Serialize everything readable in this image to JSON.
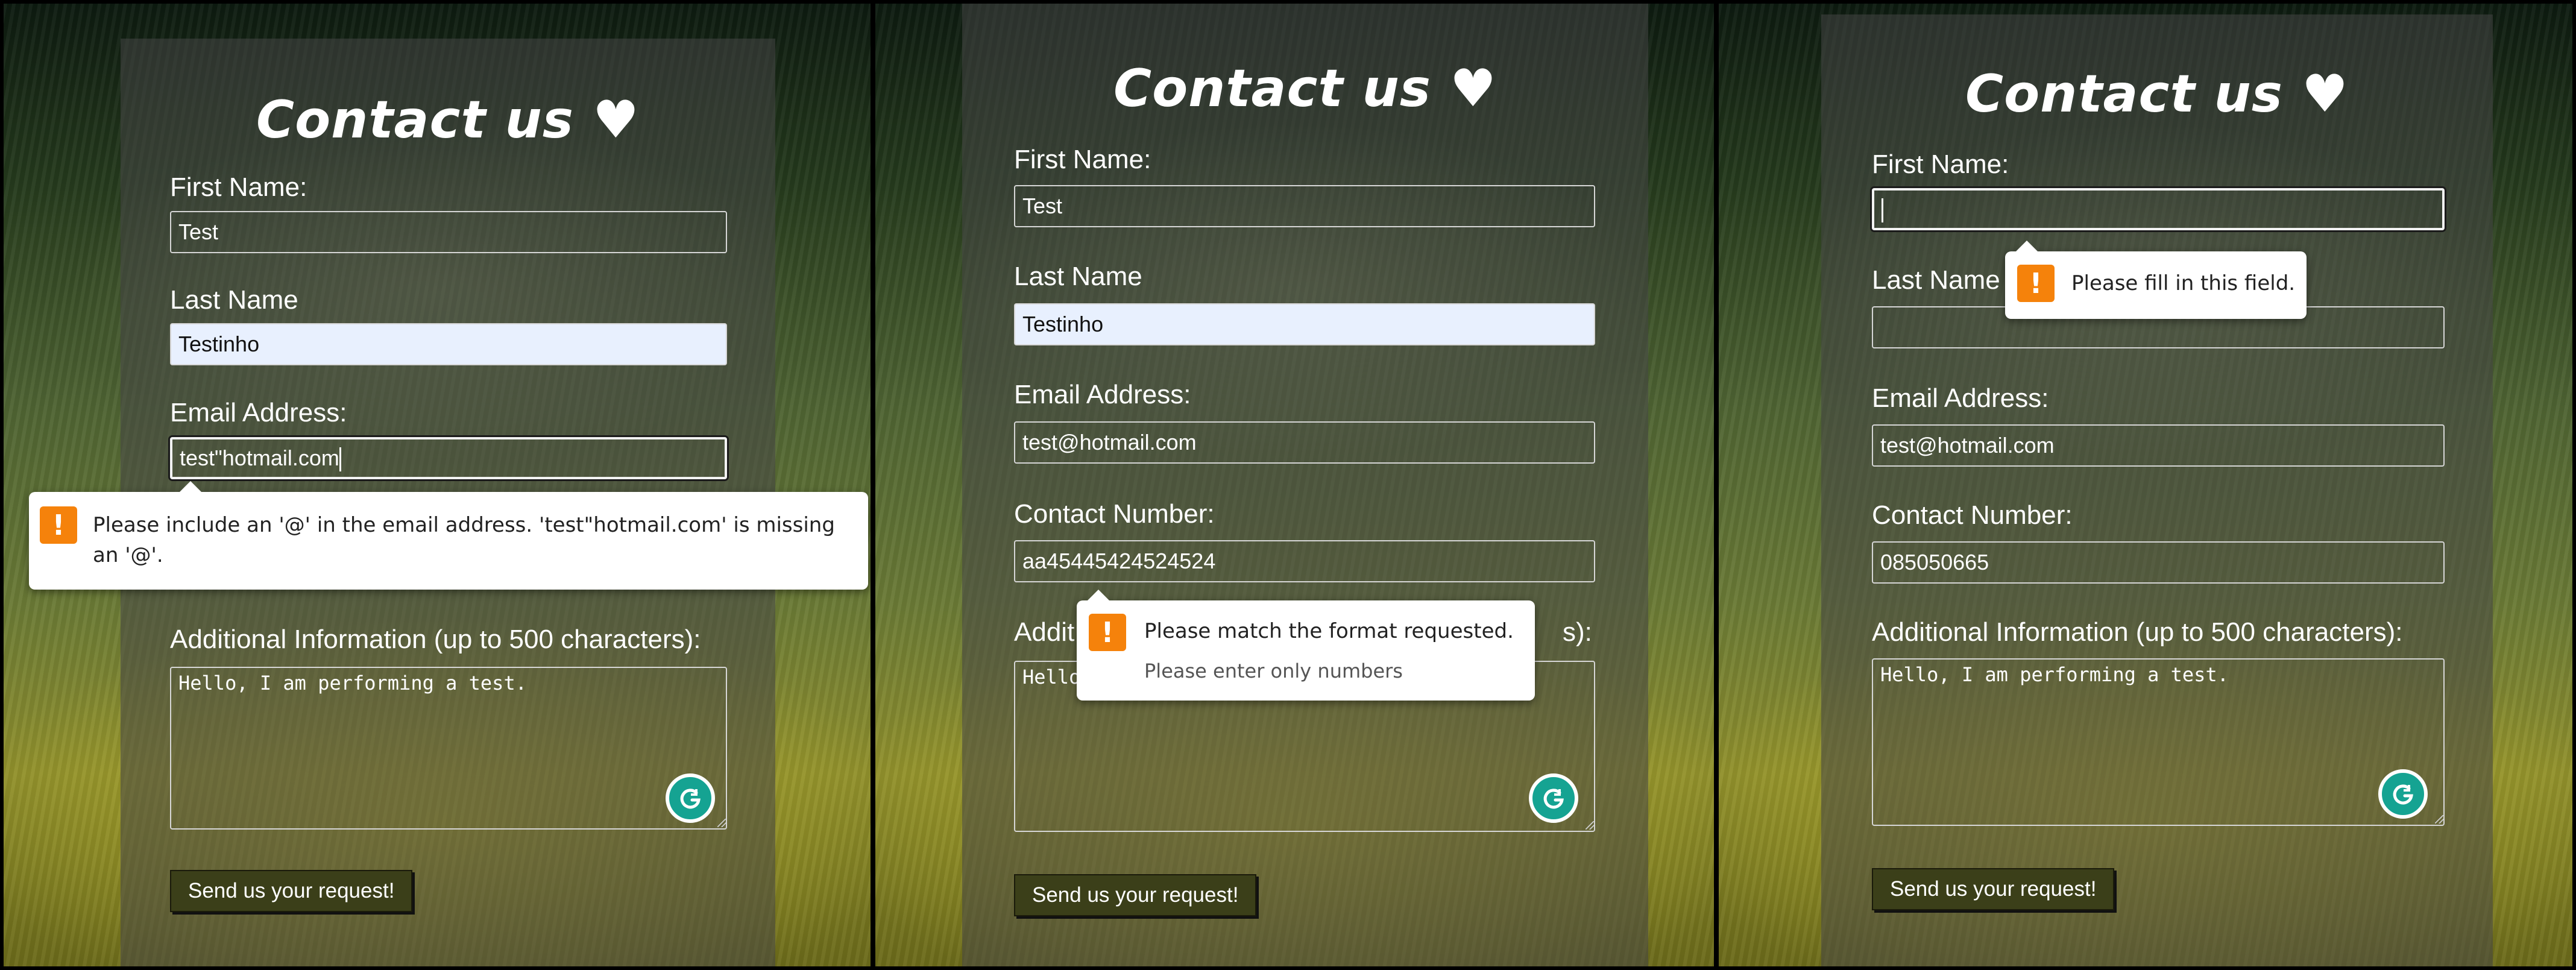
{
  "labels": {
    "title": "Contact us ♥",
    "first_name": "First Name:",
    "last_name": "Last Name",
    "email": "Email Address:",
    "contact": "Contact Number:",
    "additional": "Additional Information (up to 500 characters):",
    "submit": "Send us your request!"
  },
  "icons": {
    "warning": "!",
    "grammarly": "grammarly-icon",
    "heart": "heart-icon"
  },
  "colors": {
    "submit_bg": "#3b3f19",
    "autofill_bg": "#e8f0fe",
    "warning": "#f5820b",
    "grammarly": "#15a392"
  },
  "panel1": {
    "first_name": "Test",
    "last_name": "Testinho",
    "email": "test\"hotmail.com",
    "additional": "Hello, I am performing a test.",
    "tooltip": "Please include an '@' in the email address. 'test\"hotmail.com' is missing an '@'."
  },
  "panel2": {
    "first_name": "Test",
    "last_name": "Testinho",
    "email": "test@hotmail.com",
    "contact": "aa45445424524524",
    "additional": "Hello, I am performing a test.",
    "additional_visible": "Hello",
    "additional_label_head": "Addit",
    "additional_label_tail": "s):",
    "tooltip": "Please match the format requested.",
    "tooltip_sub": "Please enter only numbers"
  },
  "panel3": {
    "first_name": "",
    "last_name": "",
    "email": "test@hotmail.com",
    "contact": "085050665",
    "additional": "Hello, I am performing a test.",
    "tooltip": "Please fill in this field."
  }
}
